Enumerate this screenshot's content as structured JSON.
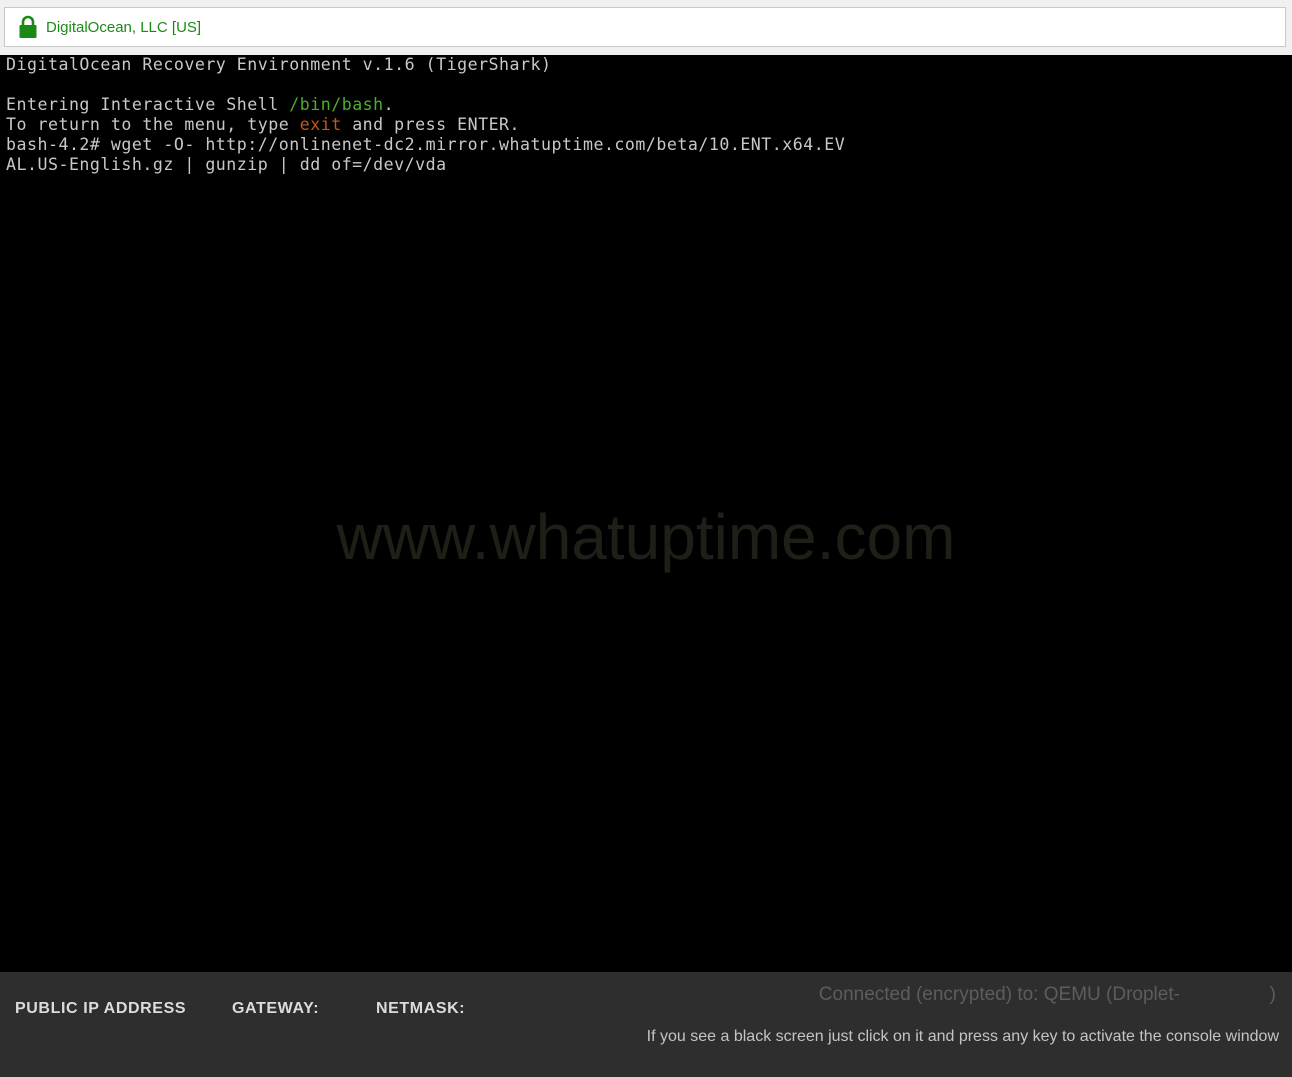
{
  "addressbar": {
    "lock_icon": "lock-icon",
    "site_identity": "DigitalOcean, LLC [US]",
    "identity_color": "#1a8a16"
  },
  "terminal": {
    "background": "#000000",
    "lines": {
      "l1": "DigitalOcean Recovery Environment v.1.6 (TigerShark)",
      "l2_a": "Entering Interactive Shell ",
      "l2_b": "/bin/bash",
      "l2_c": ".",
      "l3_a": "To return to the menu, type ",
      "l3_b": "exit",
      "l3_c": " and press ENTER.",
      "l4": "bash-4.2# wget -O- http://onlinenet-dc2.mirror.whatuptime.com/beta/10.ENT.x64.EV",
      "l5": "AL.US-English.gz | gunzip | dd of=/dev/vda"
    },
    "watermark": "www.whatuptime.com"
  },
  "footer": {
    "public_ip_label": "PUBLIC IP ADDRESS",
    "gateway_label": "GATEWAY:",
    "netmask_label": "NETMASK:",
    "status": "Connected (encrypted) to: QEMU (Droplet-                 )",
    "hint": "If you see a black screen just click on it and press any key to activate the console window"
  }
}
